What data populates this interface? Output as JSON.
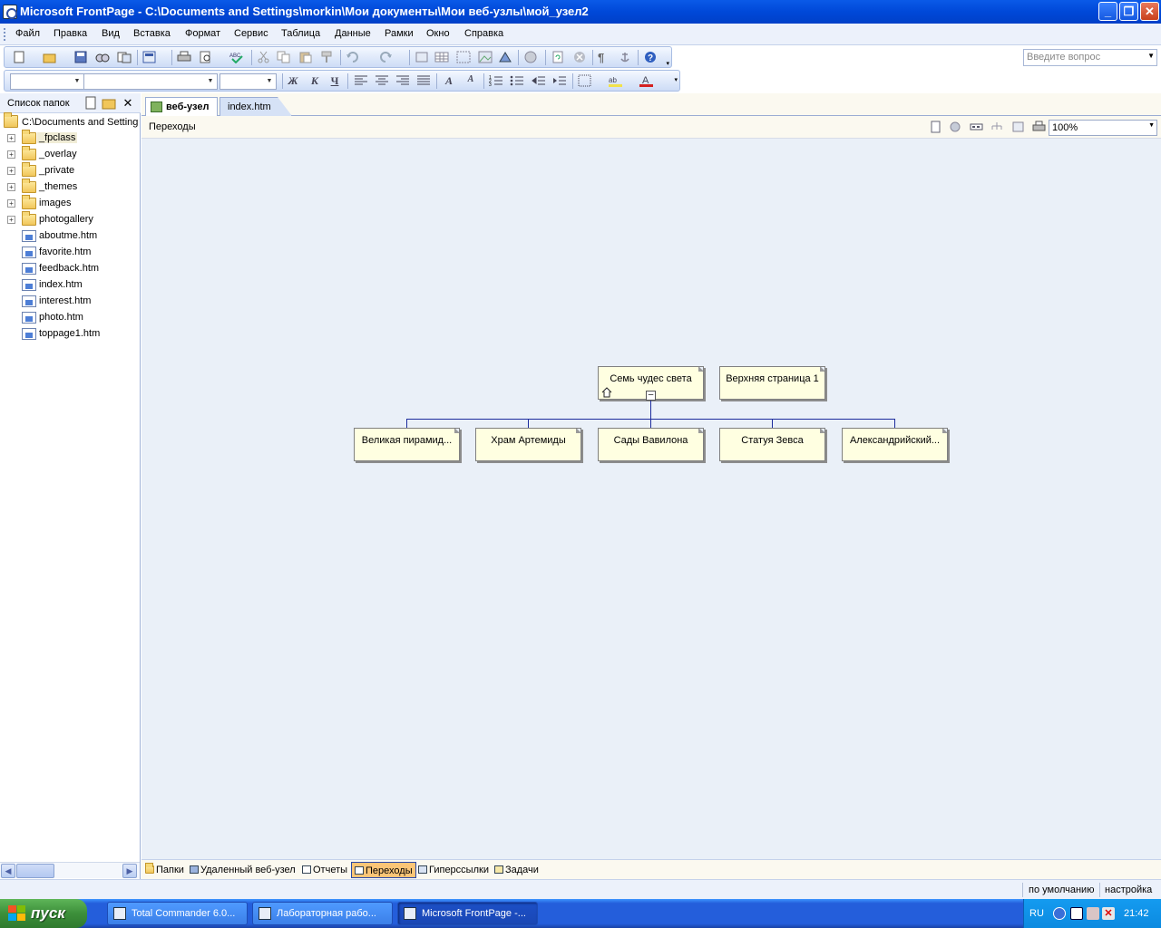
{
  "window": {
    "title": "Microsoft FrontPage - C:\\Documents and Settings\\morkin\\Мои документы\\Мои веб-узлы\\мой_узел2"
  },
  "menu": {
    "items": [
      "Файл",
      "Правка",
      "Вид",
      "Вставка",
      "Формат",
      "Сервис",
      "Таблица",
      "Данные",
      "Рамки",
      "Окно",
      "Справка"
    ],
    "help_placeholder": "Введите вопрос"
  },
  "folder_list": {
    "title": "Список папок",
    "root": "C:\\Documents and Setting",
    "items": [
      {
        "name": "_fpclass",
        "type": "folder"
      },
      {
        "name": "_overlay",
        "type": "folder"
      },
      {
        "name": "_private",
        "type": "folder"
      },
      {
        "name": "_themes",
        "type": "folder"
      },
      {
        "name": "images",
        "type": "folder"
      },
      {
        "name": "photogallery",
        "type": "folder"
      },
      {
        "name": "aboutme.htm",
        "type": "page"
      },
      {
        "name": "favorite.htm",
        "type": "page"
      },
      {
        "name": "feedback.htm",
        "type": "page"
      },
      {
        "name": "index.htm",
        "type": "page"
      },
      {
        "name": "interest.htm",
        "type": "page"
      },
      {
        "name": "photo.htm",
        "type": "page"
      },
      {
        "name": "toppage1.htm",
        "type": "page"
      }
    ]
  },
  "tabs": [
    "веб-узел",
    "index.htm"
  ],
  "view": {
    "title": "Переходы",
    "zoom": "100%"
  },
  "navigation": {
    "home": "Семь чудес света",
    "top_page": "Верхняя страница 1",
    "children": [
      "Великая пирамид...",
      "Храм Артемиды",
      "Сады Вавилона",
      "Статуя Зевса",
      "Александрийский..."
    ]
  },
  "view_tabs": [
    "Папки",
    "Удаленный веб-узел",
    "Отчеты",
    "Переходы",
    "Гиперссылки",
    "Задачи"
  ],
  "status": {
    "left": "по умолчанию",
    "right": "настройка"
  },
  "taskbar": {
    "start": "пуск",
    "tasks": [
      "Total Commander 6.0...",
      "Лабораторная рабо...",
      "Microsoft FrontPage -..."
    ],
    "lang": "RU",
    "clock": "21:42"
  }
}
